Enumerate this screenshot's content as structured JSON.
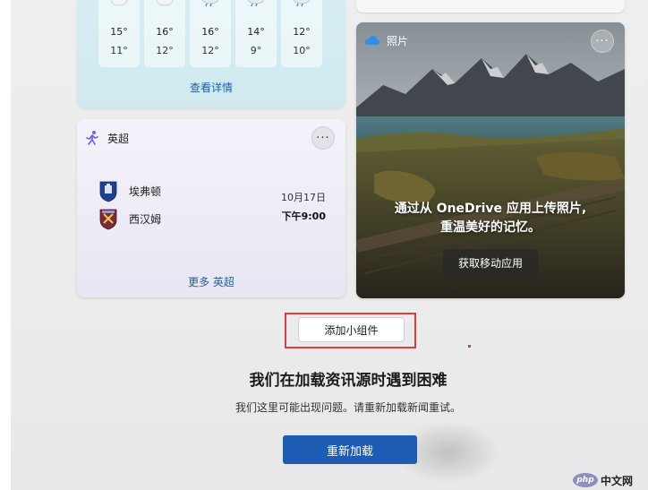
{
  "weather": {
    "days": [
      {
        "high": "15°",
        "low": "11°",
        "icon": "cloudy-icon"
      },
      {
        "high": "16°",
        "low": "12°",
        "icon": "cloudy-icon"
      },
      {
        "high": "16°",
        "low": "12°",
        "icon": "rain-icon"
      },
      {
        "high": "14°",
        "low": "9°",
        "icon": "rain-icon"
      },
      {
        "high": "12°",
        "low": "10°",
        "icon": "rain-icon"
      }
    ],
    "more_label": "查看详情"
  },
  "sports": {
    "title": "英超",
    "home_team": "埃弗顿",
    "away_team": "西汉姆",
    "match_date": "10月17日",
    "match_time": "下午9:00",
    "more_label": "更多 英超",
    "accent_color": "#7a5af5"
  },
  "photos": {
    "title": "照片",
    "message_line1": "通过从 OneDrive 应用上传照片,",
    "message_line2": "重温美好的记忆。",
    "cta_label": "获取移动应用"
  },
  "add_widget_label": "添加小组件",
  "error": {
    "title": "我们在加载资讯源时遇到困难",
    "description": "我们这里可能出现问题。请重新加载新闻重试。",
    "reload_label": "重新加载"
  },
  "watermark": {
    "badge": "php",
    "text": "中文网"
  },
  "colors": {
    "primary_button": "#1c5cb5",
    "link": "#1f5fa8",
    "highlight": "#e23b3b"
  }
}
